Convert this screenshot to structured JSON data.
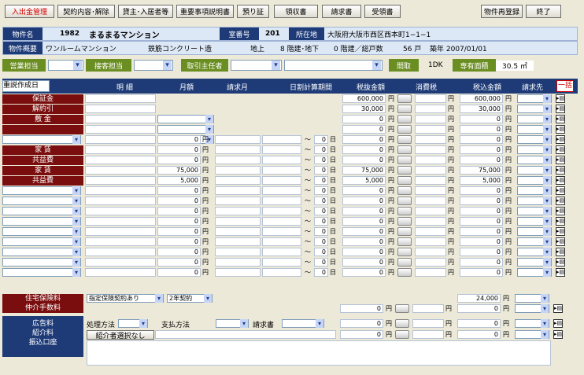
{
  "toolbar": {
    "b1": "入出金管理",
    "b2": "契約内容･解除",
    "b3": "貸主･入居者等",
    "b4": "重要事項説明書",
    "b5": "預り証",
    "b6": "領収書",
    "b7": "請求書",
    "b8": "受領書",
    "b9": "物件再登録",
    "b10": "終了"
  },
  "info": {
    "l_name": "物件名",
    "id": "1982",
    "name": "まるまるマンション",
    "l_room": "室番号",
    "room": "201",
    "l_loc": "所在地",
    "loc": "大阪府大阪市西区西本町1−1−1",
    "l_outline": "物件概要",
    "type": "ワンルームマンション",
    "struct": "鉄筋コンクリート造",
    "above": "地上",
    "floors": "8 階建･地下",
    "under": "0 階建／総戸数",
    "units": "56 戸",
    "built": "築年 2007/01/01",
    "l_sales": "営業担当",
    "l_recv": "接客担当",
    "l_broker": "取引主任者",
    "l_layout": "間取",
    "layout": "1DK",
    "l_area": "専有面積",
    "area": "30.5 ㎡"
  },
  "cols": {
    "c1": "重説作成日",
    "c2": "明 細",
    "c3": "月額",
    "c4": "請求月",
    "c5": "日割計算期間",
    "c6": "税抜金額",
    "c7": "消費税",
    "c8": "税込金額",
    "c9": "請求先",
    "c10": "一括"
  },
  "rows": [
    {
      "label": "保証金",
      "monthly": "",
      "net": "600,000",
      "gross": "600,000",
      "yen": "円",
      "dd": false
    },
    {
      "label": "解約引",
      "monthly": "",
      "net": "30,000",
      "gross": "30,000",
      "yen": "円",
      "dd": false
    },
    {
      "label": "敷 金",
      "monthly": "",
      "net": "0",
      "gross": "0",
      "yen": "円",
      "dd": false
    },
    {
      "label": "",
      "monthly": "",
      "net": "0",
      "gross": "0",
      "yen": "円",
      "dd": false
    },
    {
      "label": "",
      "monthly": "0",
      "net": "0",
      "gross": "0",
      "yen": "円",
      "dd": true
    },
    {
      "label": "家 賃",
      "monthly": "0",
      "net": "0",
      "gross": "0",
      "yen": "円",
      "dd": false
    },
    {
      "label": "共益費",
      "monthly": "0",
      "net": "0",
      "gross": "0",
      "yen": "円",
      "dd": false
    },
    {
      "label": "家 賃",
      "monthly": "75,000",
      "net": "75,000",
      "gross": "75,000",
      "yen": "円",
      "dd": false
    },
    {
      "label": "共益費",
      "monthly": "5,000",
      "net": "5,000",
      "gross": "5,000",
      "yen": "円",
      "dd": false
    },
    {
      "label": "",
      "monthly": "0",
      "net": "0",
      "gross": "0",
      "yen": "円",
      "dd": true
    },
    {
      "label": "",
      "monthly": "0",
      "net": "0",
      "gross": "0",
      "yen": "円",
      "dd": true
    },
    {
      "label": "",
      "monthly": "0",
      "net": "0",
      "gross": "0",
      "yen": "円",
      "dd": true
    },
    {
      "label": "",
      "monthly": "0",
      "net": "0",
      "gross": "0",
      "yen": "円",
      "dd": true
    },
    {
      "label": "",
      "monthly": "0",
      "net": "0",
      "gross": "0",
      "yen": "円",
      "dd": true
    },
    {
      "label": "",
      "monthly": "0",
      "net": "0",
      "gross": "0",
      "yen": "円",
      "dd": true
    },
    {
      "label": "",
      "monthly": "0",
      "net": "0",
      "gross": "0",
      "yen": "円",
      "dd": true
    },
    {
      "label": "",
      "monthly": "0",
      "net": "0",
      "gross": "0",
      "yen": "円",
      "dd": true
    },
    {
      "label": "",
      "monthly": "0",
      "net": "0",
      "gross": "0",
      "yen": "円",
      "dd": true
    }
  ],
  "days": "0",
  "day_unit": "日",
  "tilde": "～",
  "insurance": {
    "label": "住宅保険料",
    "choice": "指定保険契約あり",
    "term": "2年契約",
    "gross": "24,000"
  },
  "brokerage": {
    "label": "仲介手数料",
    "net": "0",
    "gross": "0"
  },
  "ad": {
    "label": "広告料",
    "method": "処理方法",
    "pay": "支払方法",
    "invoice": "請求書",
    "net": "0",
    "gross": "0"
  },
  "intro": {
    "label": "紹介料",
    "select": "紹介者選択なし",
    "net": "0",
    "gross": "0"
  },
  "bank": {
    "label": "振込口座"
  },
  "yen": "円"
}
